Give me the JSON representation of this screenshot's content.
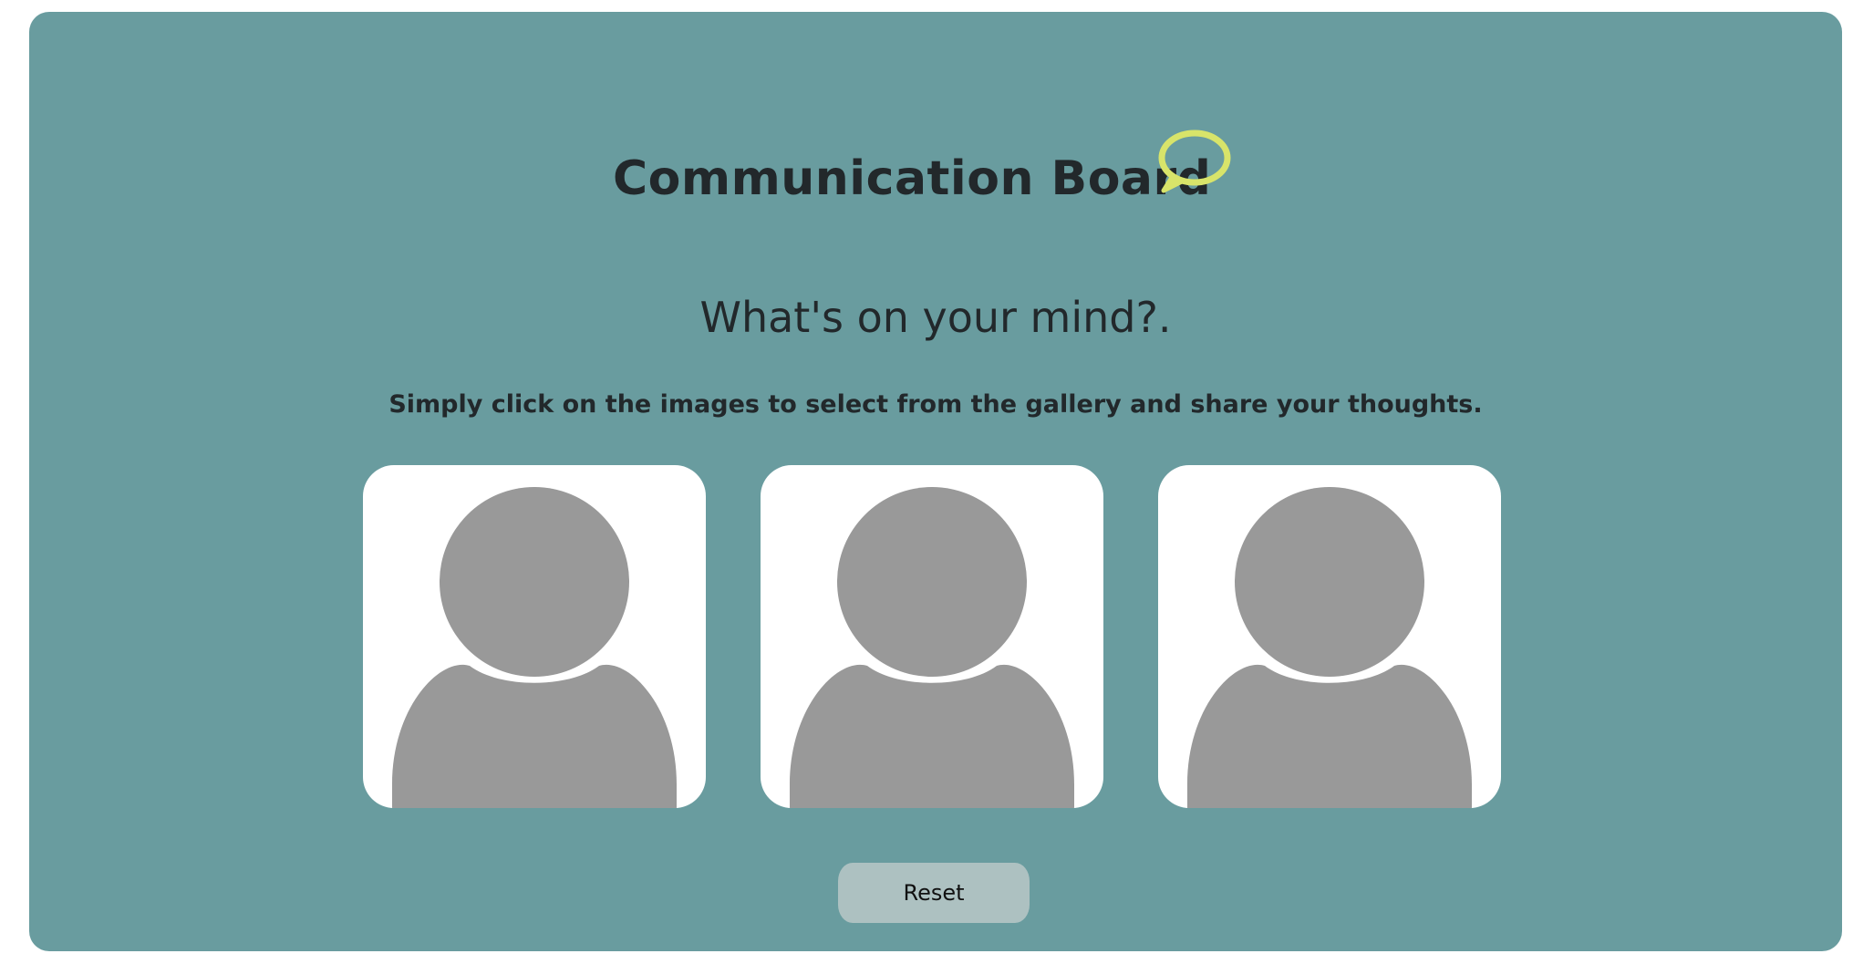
{
  "header": {
    "title": "Communication Board",
    "icon": "speech-bubble-icon",
    "icon_color": "#d8e46a"
  },
  "prompt": {
    "question": "What's on your mind?.",
    "instructions": "Simply click on the images to select from the gallery and share your thoughts."
  },
  "gallery": {
    "slots": [
      {
        "icon": "person-placeholder-icon"
      },
      {
        "icon": "person-placeholder-icon"
      },
      {
        "icon": "person-placeholder-icon"
      }
    ]
  },
  "controls": {
    "reset_label": "Reset"
  },
  "colors": {
    "board_background": "#699c9f",
    "text": "#22282b",
    "placeholder": "#999999",
    "button": "#adc1c1"
  }
}
